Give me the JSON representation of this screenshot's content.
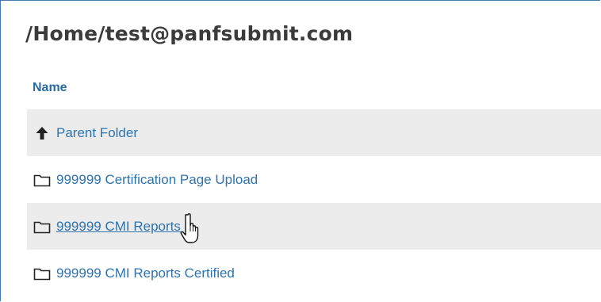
{
  "breadcrumb": {
    "path": "/Home/test@panfsubmit.com"
  },
  "table": {
    "column_header": "Name",
    "rows": [
      {
        "label": "Parent Folder",
        "icon": "arrow-up-icon",
        "shaded": true
      },
      {
        "label": "999999 Certification Page Upload",
        "icon": "folder-icon",
        "shaded": false
      },
      {
        "label": "999999 CMI Reports",
        "icon": "folder-icon",
        "shaded": true,
        "hovered": true
      },
      {
        "label": "999999 CMI Reports Certified",
        "icon": "folder-icon",
        "shaded": false
      }
    ]
  },
  "colors": {
    "link": "#2f73ad",
    "header": "#2b6aa0",
    "title": "#3b3b3b",
    "row_shade": "#ececec"
  }
}
